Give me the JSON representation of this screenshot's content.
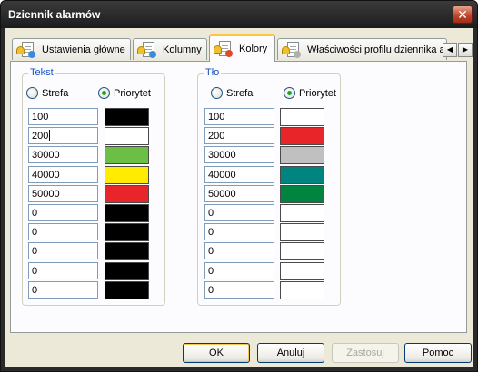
{
  "window": {
    "title": "Dziennik alarmów",
    "close_glyph": "✕"
  },
  "tabs": [
    {
      "label": "Ustawienia główne",
      "dot_color": "#3c8ad8",
      "active": false
    },
    {
      "label": "Kolumny",
      "dot_color": "#3c8ad8",
      "active": false
    },
    {
      "label": "Kolory",
      "dot_color": "#e04a2a",
      "active": true
    },
    {
      "label": "Właściwości profilu dziennika al",
      "dot_color": "#b0b0b0",
      "active": false
    }
  ],
  "tab_scroll": {
    "left": "◀",
    "right": "▶"
  },
  "tekst": {
    "title": "Tekst",
    "radio_zone": "Strefa",
    "radio_priority": "Priorytet",
    "selected": "Priorytet",
    "values": [
      "100",
      "200",
      "30000",
      "40000",
      "50000",
      "0",
      "0",
      "0",
      "0",
      "0"
    ],
    "colors": [
      "#000000",
      "#ffffff",
      "#6cbf45",
      "#ffec00",
      "#e8262a",
      "#000000",
      "#000000",
      "#000000",
      "#000000",
      "#000000"
    ]
  },
  "tlo": {
    "title": "Tło",
    "radio_zone": "Strefa",
    "radio_priority": "Priorytet",
    "selected": "Priorytet",
    "values": [
      "100",
      "200",
      "30000",
      "40000",
      "50000",
      "0",
      "0",
      "0",
      "0",
      "0"
    ],
    "colors": [
      "#ffffff",
      "#e8262a",
      "#c0c0c0",
      "#00847f",
      "#00843f",
      "#ffffff",
      "#ffffff",
      "#ffffff",
      "#ffffff",
      "#ffffff"
    ]
  },
  "buttons": {
    "ok": "OK",
    "cancel": "Anuluj",
    "apply": "Zastosuj",
    "help": "Pomoc"
  }
}
